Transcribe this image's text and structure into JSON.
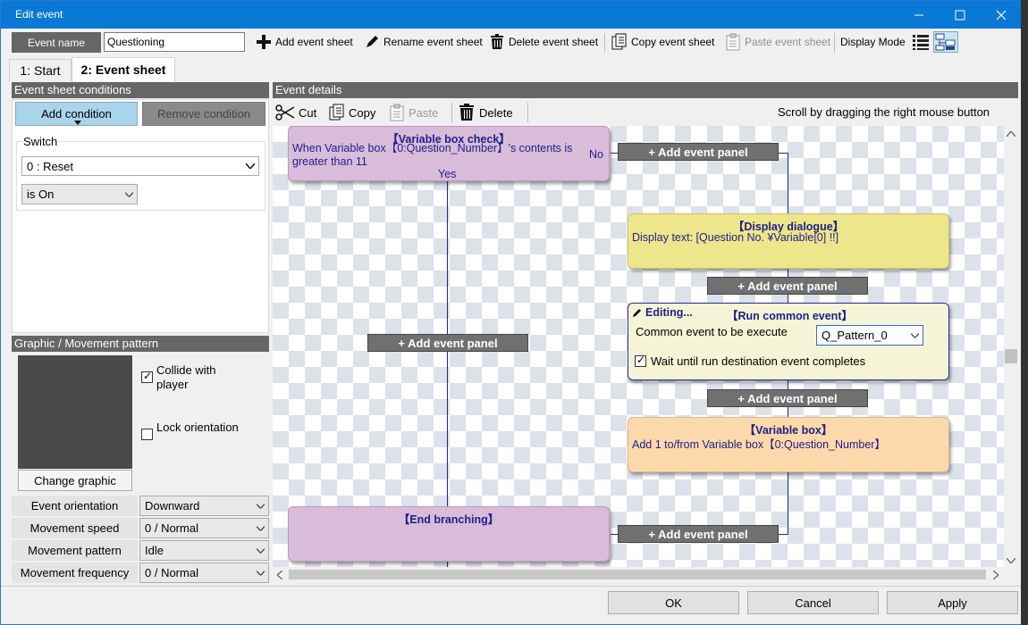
{
  "window": {
    "title": "Edit event"
  },
  "toolbar": {
    "event_name_label": "Event name",
    "event_name_value": "Questioning",
    "add_sheet": "Add event sheet",
    "rename_sheet": "Rename event sheet",
    "delete_sheet": "Delete event sheet",
    "copy_sheet": "Copy event sheet",
    "paste_sheet": "Paste event sheet",
    "display_mode": "Display Mode"
  },
  "tabs": [
    {
      "label": "1: Start"
    },
    {
      "label": "2: Event sheet"
    }
  ],
  "conditions": {
    "header": "Event sheet conditions",
    "add_button": "Add condition",
    "remove_button": "Remove condition",
    "switch_label": "Switch",
    "switch_value": "0 : Reset",
    "state_value": "is On"
  },
  "graphic": {
    "header": "Graphic / Movement pattern",
    "collide_label": "Collide  with player",
    "lock_label": "Lock orientation",
    "change_button": "Change graphic",
    "collide_checked": true,
    "lock_checked": false
  },
  "props": [
    {
      "label": "Event orientation",
      "value": "Downward"
    },
    {
      "label": "Movement speed",
      "value": "0 / Normal"
    },
    {
      "label": "Movement pattern",
      "value": "Idle"
    },
    {
      "label": "Movement frequency",
      "value": "0 / Normal"
    }
  ],
  "details": {
    "header": "Event details",
    "cut": "Cut",
    "copy": "Copy",
    "paste": "Paste",
    "delete": "Delete",
    "hint": "Scroll by dragging the right mouse button"
  },
  "canvas": {
    "var_check_title": "【Variable box check】",
    "var_check_text": "When Variable box【0:Question_Number】's contents is greater than 11",
    "no_label": "No",
    "yes_label": "Yes",
    "add_panel": "+ Add event panel",
    "dialogue_title": "【Display dialogue】",
    "dialogue_text": "Display text: [Question No. ¥Variable[0] !!]",
    "editing_label": "Editing...",
    "common_title": "【Run common event】",
    "common_label": "Common event to be execute",
    "common_value": "Q_Pattern_0",
    "wait_label": "Wait until run destination event completes",
    "wait_checked": true,
    "varbox_title": "【Variable box】",
    "varbox_text": "Add 1 to/from Variable box【0:Question_Number】",
    "end_title": "【End branching】"
  },
  "footer": {
    "ok": "OK",
    "cancel": "Cancel",
    "apply": "Apply"
  },
  "colors": {
    "titlebar": "#0a78d7",
    "var_check_card": "#d9bcd9",
    "dialogue_card": "#eee68a",
    "common_card": "#f6f4d6",
    "varbox_card": "#fcd9aa",
    "end_card": "#d9bcd9",
    "connector": "#1a2a8a"
  }
}
